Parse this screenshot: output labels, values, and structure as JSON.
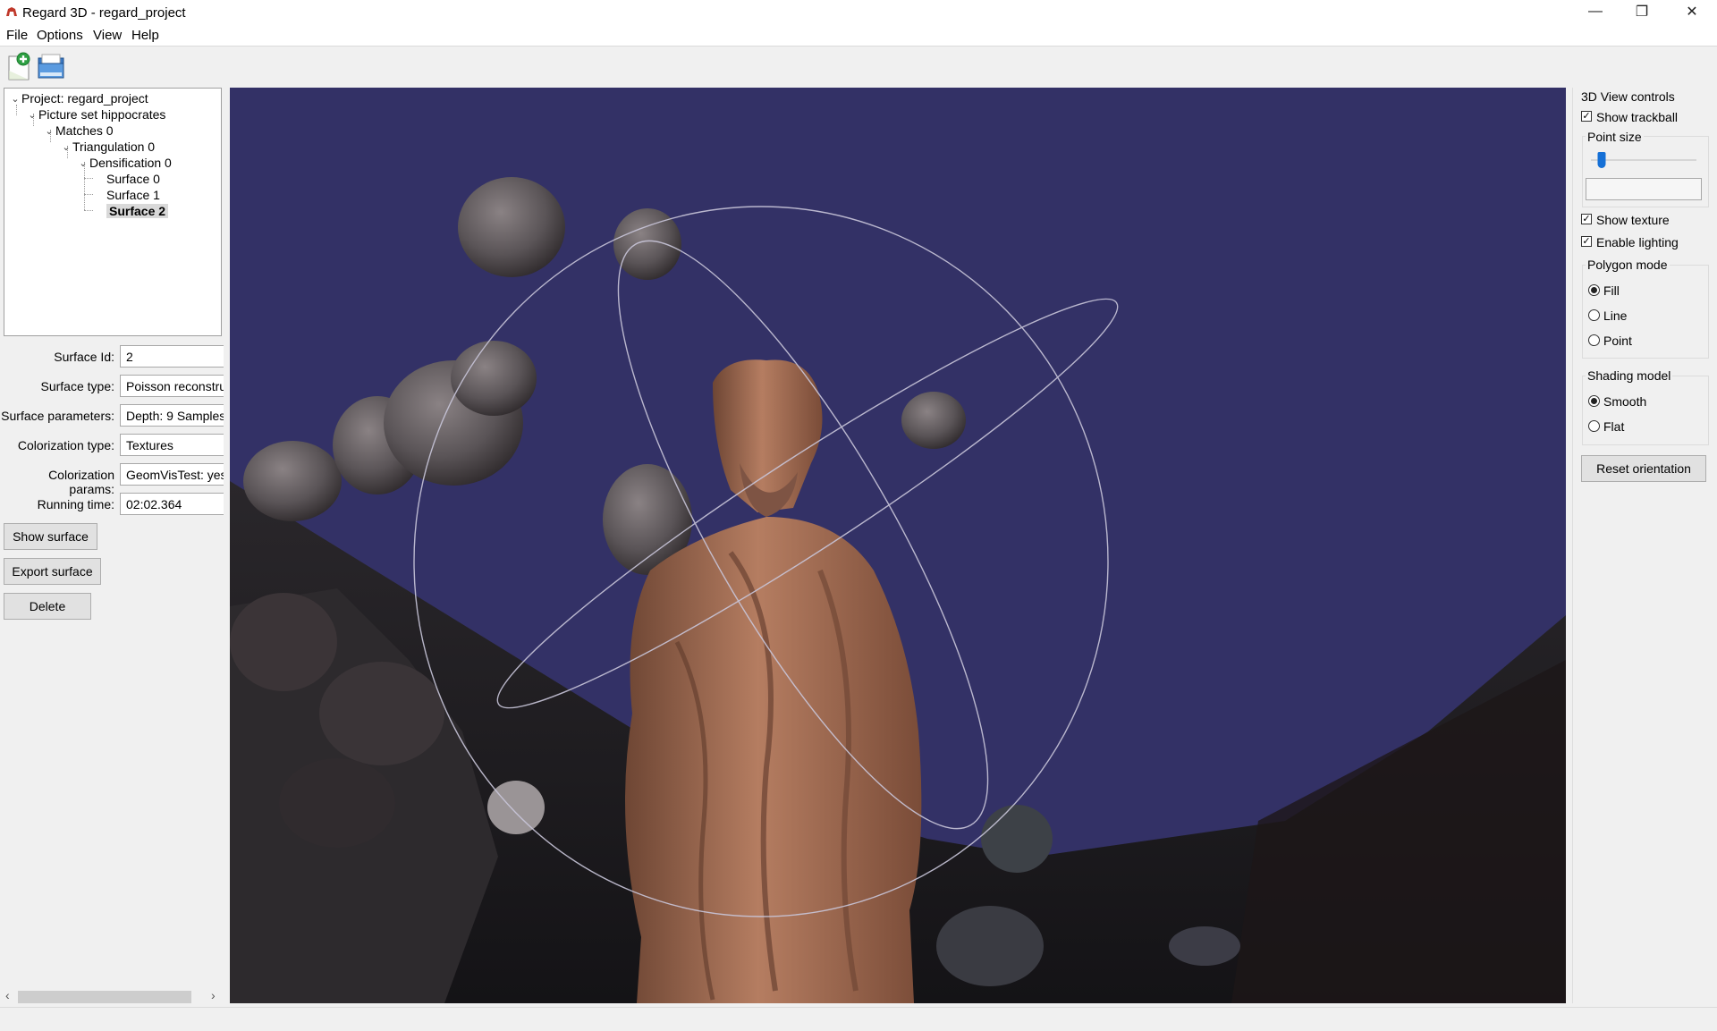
{
  "window": {
    "title": "Regard 3D - regard_project",
    "minimize_glyph": "—",
    "maximize_glyph": "❐",
    "close_glyph": "✕"
  },
  "menu": [
    "File",
    "Options",
    "View",
    "Help"
  ],
  "toolbar": {
    "icons": [
      "new-project-icon",
      "open-project-icon"
    ]
  },
  "tree": {
    "items": [
      {
        "label": "Project: regard_project",
        "expanded": true
      },
      {
        "label": "Picture set hippocrates",
        "expanded": true
      },
      {
        "label": "Matches 0",
        "expanded": true
      },
      {
        "label": "Triangulation 0",
        "expanded": true
      },
      {
        "label": "Densification 0",
        "expanded": true
      },
      {
        "label": "Surface 0"
      },
      {
        "label": "Surface 1"
      },
      {
        "label": "Surface 2",
        "selected": true
      }
    ]
  },
  "properties": [
    {
      "label": "Surface Id:",
      "value": "2"
    },
    {
      "label": "Surface type:",
      "value": "Poisson reconstru"
    },
    {
      "label": "Surface parameters:",
      "value": "Depth: 9 Samples"
    },
    {
      "label": "Colorization type:",
      "value": "Textures"
    },
    {
      "label": "Colorization params:",
      "value": "GeomVisTest: yes"
    },
    {
      "label": "Running time:",
      "value": "02:02.364"
    }
  ],
  "buttons": {
    "show_surface": "Show surface",
    "export_surface": "Export surface",
    "delete": "Delete"
  },
  "scroll": {
    "left": "‹",
    "right": "›"
  },
  "view_controls": {
    "title": "3D View controls",
    "show_trackball": {
      "label": "Show trackball",
      "checked": true
    },
    "point_size_label": "Point size",
    "point_size_value": 0.1,
    "point_size_field": "",
    "show_texture": {
      "label": "Show texture",
      "checked": true
    },
    "enable_lighting": {
      "label": "Enable lighting",
      "checked": true
    },
    "polygon_mode": {
      "title": "Polygon mode",
      "options": [
        "Fill",
        "Line",
        "Point"
      ],
      "selected": "Fill"
    },
    "shading_model": {
      "title": "Shading model",
      "options": [
        "Smooth",
        "Flat"
      ],
      "selected": "Smooth"
    },
    "reset_orientation": "Reset orientation"
  },
  "colors": {
    "viewport_bg": "#333166",
    "ground": "#1c1b1f",
    "statue": "#a86f55",
    "rock": "#5a5457"
  }
}
